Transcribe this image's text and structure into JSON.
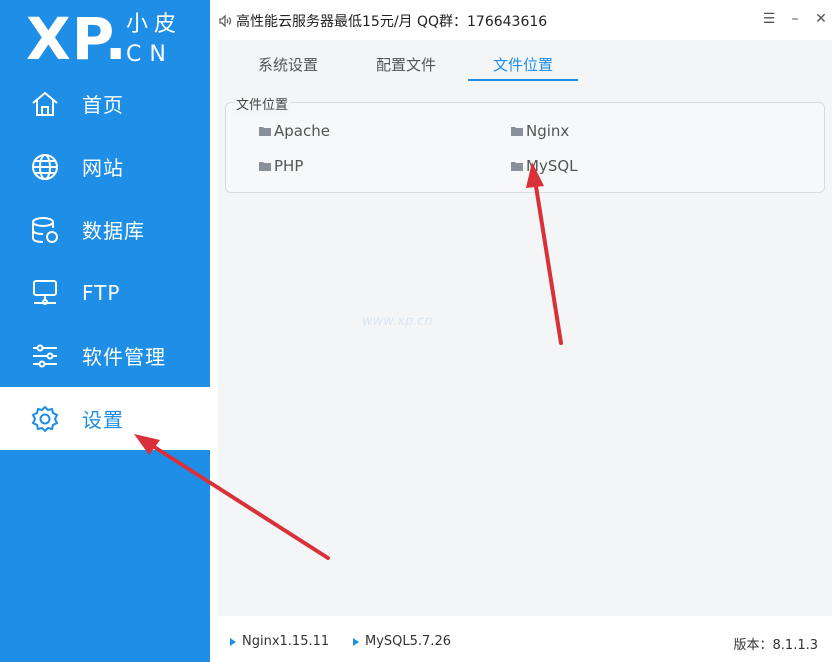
{
  "logo": {
    "main": "XP.",
    "cn_top": "小皮",
    "cn_bottom": "CN"
  },
  "sidebar": {
    "items": [
      {
        "icon": "home-icon",
        "label": "首页",
        "active": false
      },
      {
        "icon": "globe-icon",
        "label": "网站",
        "active": false
      },
      {
        "icon": "database-icon",
        "label": "数据库",
        "active": false
      },
      {
        "icon": "ftp-icon",
        "label": "FTP",
        "active": false
      },
      {
        "icon": "sliders-icon",
        "label": "软件管理",
        "active": false
      },
      {
        "icon": "gear-icon",
        "label": "设置",
        "active": true
      }
    ]
  },
  "titlebar": {
    "notice": "高性能云服务器最低15元/月  QQ群：176643616",
    "controls": {
      "settings": "☰",
      "minimize": "–",
      "close": "✕"
    }
  },
  "tabs": [
    {
      "label": "系统设置",
      "active": false
    },
    {
      "label": "配置文件",
      "active": false
    },
    {
      "label": "文件位置",
      "active": true
    }
  ],
  "file_locations": {
    "title": "文件位置",
    "items": [
      {
        "label": "Apache"
      },
      {
        "label": "Nginx"
      },
      {
        "label": "PHP"
      },
      {
        "label": "MySQL"
      }
    ]
  },
  "watermark": "www.xp.cn",
  "statusbar": {
    "nginx": "Nginx1.15.11",
    "mysql": "MySQL5.7.26",
    "version_label": "版本：8.1.1.3"
  },
  "colors": {
    "primary": "#1e8ee6",
    "annotation_arrow": "#d9313a"
  }
}
